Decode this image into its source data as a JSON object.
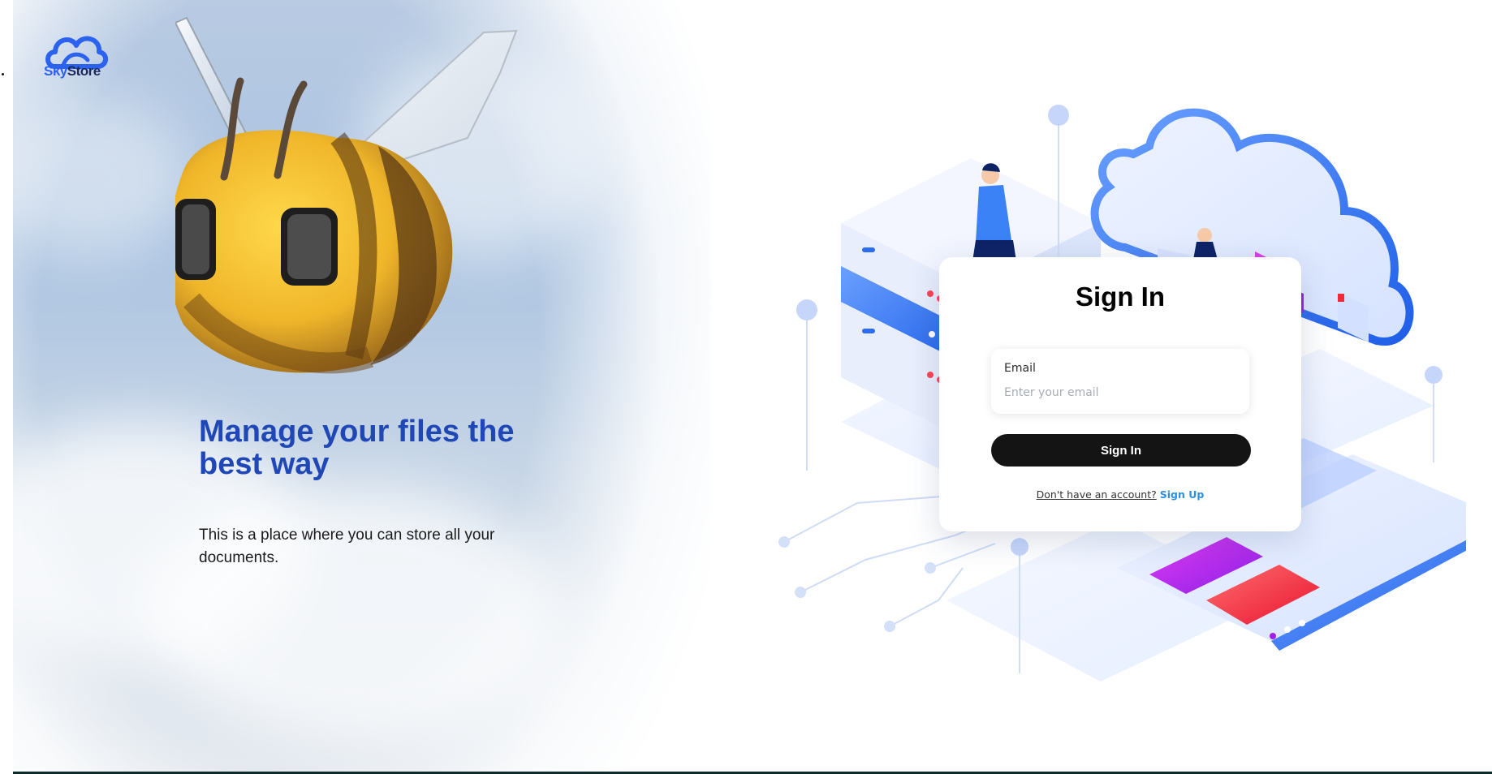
{
  "brand": {
    "name_part1": "Sky",
    "name_part2": "Store"
  },
  "hero": {
    "headline_part1": "Manage your files the",
    "headline_part2": "best way",
    "subtext": "This is a place where you can store all your documents."
  },
  "signin": {
    "title": "Sign In",
    "email_label": "Email",
    "email_placeholder": "Enter your email",
    "email_value": "",
    "submit_label": "Sign In",
    "signup_prompt": "Don't have an account?",
    "signup_link": "Sign Up"
  },
  "colors": {
    "brand_blue": "#2b62f0",
    "headline_blue": "#1f47b6",
    "button_dark": "#141414",
    "link_blue": "#2f8fe3"
  },
  "icons": {
    "logo": "cloud-logo-icon",
    "hero_image": "bee-illustration",
    "side_image": "cloud-storage-illustration"
  }
}
